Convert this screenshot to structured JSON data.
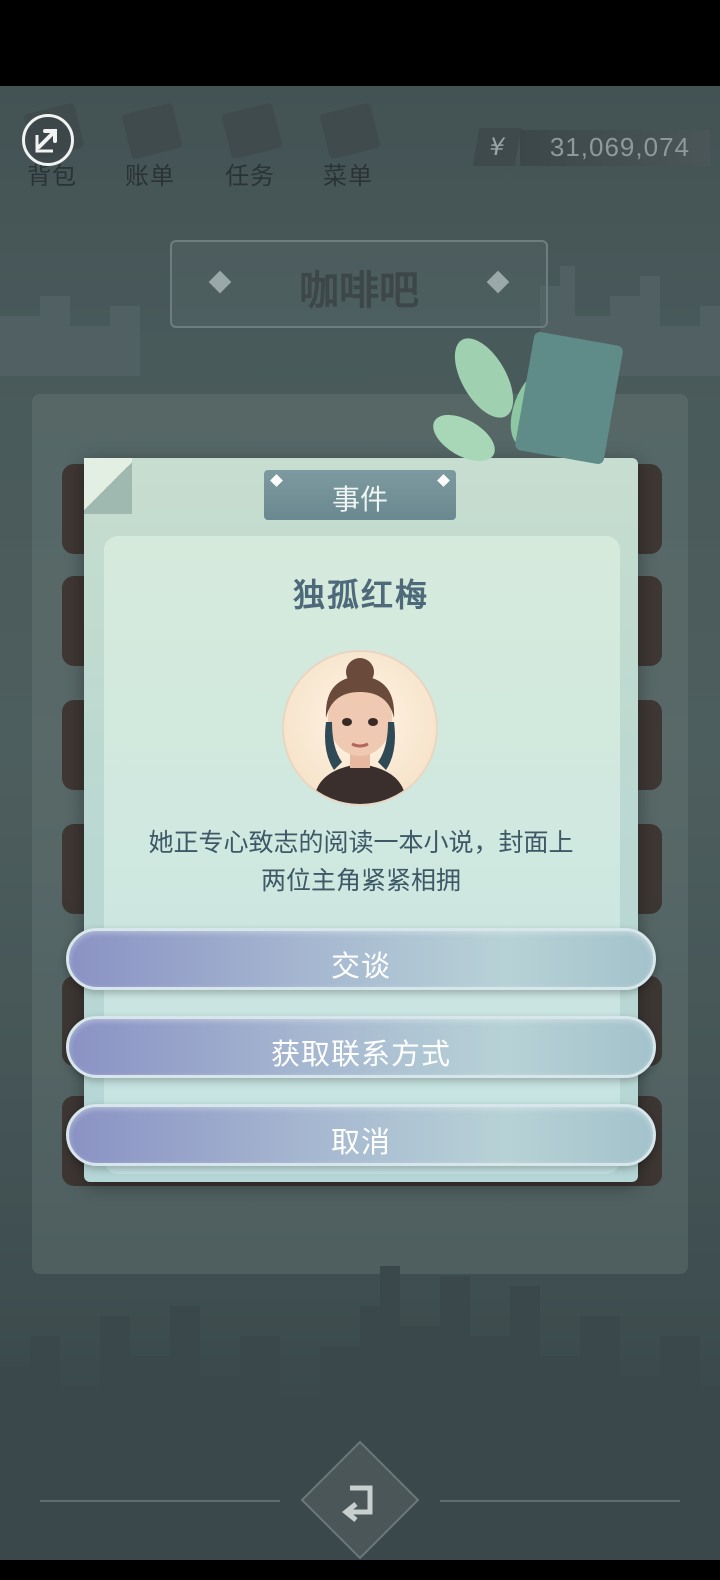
{
  "nav": {
    "items": [
      {
        "label": "背包"
      },
      {
        "label": "账单"
      },
      {
        "label": "任务"
      },
      {
        "label": "菜单"
      }
    ],
    "money_symbol": "¥",
    "money_value": "31,069,074"
  },
  "shop": {
    "title": "咖啡吧"
  },
  "dialog": {
    "header": "事件",
    "npc_name": "独孤红梅",
    "text_line1": "她正专心致志的阅读一本小说，封面上",
    "text_line2": "两位主角紧紧相拥",
    "choices": [
      {
        "label": "交谈"
      },
      {
        "label": "获取联系方式"
      },
      {
        "label": "取消"
      }
    ]
  }
}
